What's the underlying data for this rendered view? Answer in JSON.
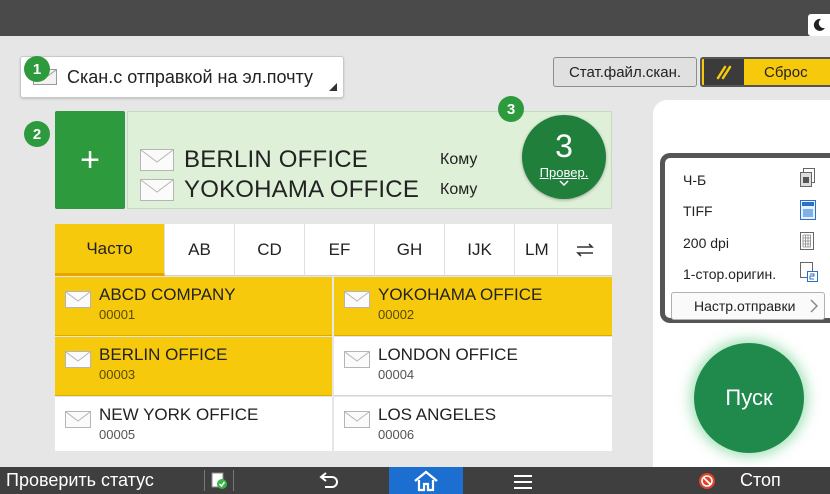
{
  "function_select": {
    "label": "Скан.с отправкой на эл.почту"
  },
  "badges": {
    "b1": "1",
    "b2": "2",
    "b3": "3"
  },
  "toolbar": {
    "schedule_label": "Стат.файл.скан.",
    "reset_label": "Сброс"
  },
  "destinations": {
    "add_label": "+",
    "items": [
      {
        "name": "BERLIN OFFICE",
        "type": "Кому"
      },
      {
        "name": "YOKOHAMA OFFICE",
        "type": "Кому"
      }
    ],
    "count": "3",
    "check_label": "Провер."
  },
  "tabs": [
    "Часто",
    "AB",
    "CD",
    "EF",
    "GH",
    "IJK",
    "LM"
  ],
  "address_book": [
    {
      "name": "ABCD COMPANY",
      "number": "00001",
      "selected": true
    },
    {
      "name": "YOKOHAMA OFFICE",
      "number": "00002",
      "selected": true
    },
    {
      "name": "BERLIN OFFICE",
      "number": "00003",
      "selected": true
    },
    {
      "name": "LONDON OFFICE",
      "number": "00004",
      "selected": false
    },
    {
      "name": "NEW YORK OFFICE",
      "number": "00005",
      "selected": false
    },
    {
      "name": "LOS ANGELES",
      "number": "00006",
      "selected": false
    }
  ],
  "scan_settings": {
    "color": "Ч-Б",
    "format": "TIFF",
    "resolution": "200 dpi",
    "sides": "1-стор.оригин.",
    "send_settings_label": "Настр.отправки"
  },
  "start_label": "Пуск",
  "bottom": {
    "check_status": "Проверить статус",
    "stop": "Стоп"
  },
  "colors": {
    "accent_green": "#2e9a3e",
    "selected_yellow": "#f6c90c",
    "home_blue": "#1c6fd1"
  }
}
